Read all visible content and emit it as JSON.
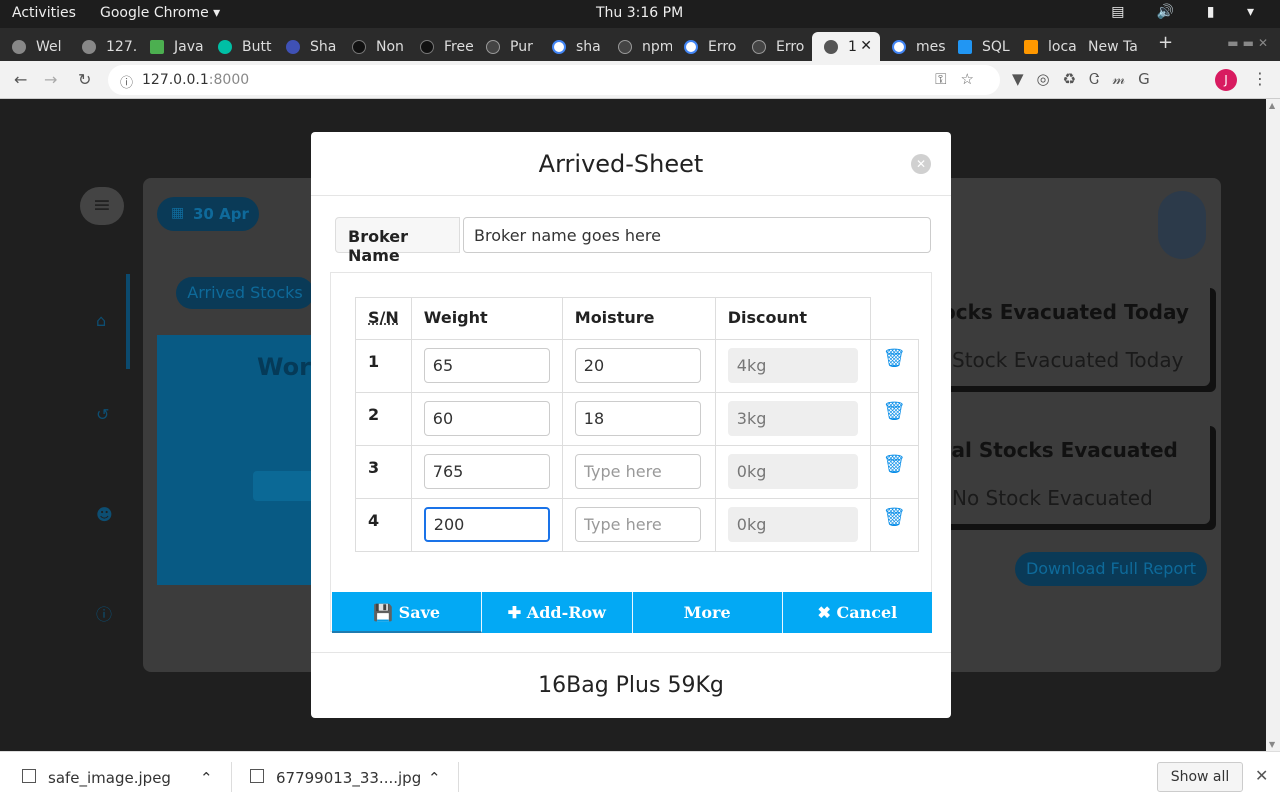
{
  "topbar": {
    "activities": "Activities",
    "app": "Google Chrome ▾",
    "clock": "Thu  3:16 PM",
    "tray": "▤ 🔊 ▮ ▾"
  },
  "tabs": [
    "Wel",
    "127.",
    "Java",
    "Butt",
    "Sha",
    "Non",
    "Free",
    "Pur",
    "sha",
    "npm",
    "Erro",
    "Erro",
    "1",
    "mes",
    "SQL",
    "loca",
    "New Ta"
  ],
  "browser": {
    "url_host": "127.0.0.1",
    "url_port": ":8000",
    "new_tab": "+"
  },
  "page": {
    "date": "30 Apr",
    "arrived_pill": "Arrived Stocks",
    "card_title": "Work",
    "stat1_title": "ocks Evacuated Today",
    "stat1_value": "Stock Evacuated Today",
    "stat2_title": "tal Stocks Evacuated",
    "stat2_value": "No Stock Evacuated",
    "download_report": "Download Full Report"
  },
  "modal": {
    "title": "Arrived-Sheet",
    "broker_label": "Broker Name",
    "broker_value": "Broker name goes here",
    "columns": [
      "S/N",
      "Weight",
      "Moisture",
      "Discount"
    ],
    "rows": [
      {
        "sn": "1",
        "weight": "65",
        "moisture": "20",
        "discount": "4kg"
      },
      {
        "sn": "2",
        "weight": "60",
        "moisture": "18",
        "discount": "3kg"
      },
      {
        "sn": "3",
        "weight": "765",
        "moisture": "",
        "discount": "0kg"
      },
      {
        "sn": "4",
        "weight": "200",
        "moisture": "",
        "discount": "0kg"
      }
    ],
    "moisture_placeholder": "Type here",
    "buttons": {
      "save": "Save",
      "add_row": "Add-Row",
      "more": "More",
      "cancel": "Cancel"
    },
    "total": "16Bag Plus 59Kg"
  },
  "downloads": {
    "items": [
      "safe_image.jpeg",
      "67799013_33....jpg"
    ],
    "show_all": "Show all"
  },
  "colors": {
    "accent": "#03a9f4",
    "trash": "#0a8ee8"
  }
}
